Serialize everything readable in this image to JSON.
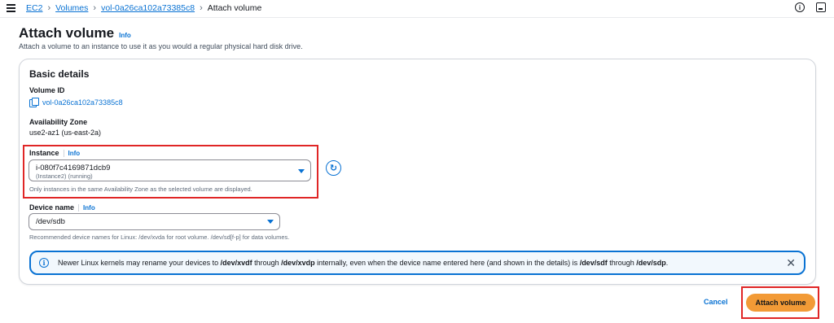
{
  "breadcrumb": {
    "items": [
      "EC2",
      "Volumes",
      "vol-0a26ca102a73385c8"
    ],
    "current": "Attach volume"
  },
  "header": {
    "title": "Attach volume",
    "info": "Info",
    "description": "Attach a volume to an instance to use it as you would a regular physical hard disk drive."
  },
  "basic_details": {
    "title": "Basic details",
    "volume_id_label": "Volume ID",
    "volume_id": "vol-0a26ca102a73385c8",
    "az_label": "Availability Zone",
    "az_value": "use2-az1 (us-east-2a)",
    "instance_label": "Instance",
    "instance_info": "Info",
    "instance_value": "i-080f7c4169871dcb9",
    "instance_sub": "(Instance2) (running)",
    "instance_hint": "Only instances in the same Availability Zone as the selected volume are displayed.",
    "device_label": "Device name",
    "device_info": "Info",
    "device_value": "/dev/sdb",
    "device_hint": "Recommended device names for Linux: /dev/xvda for root volume. /dev/sd[f-p] for data volumes."
  },
  "alert": {
    "part1": "Newer Linux kernels may rename your devices to ",
    "b1": "/dev/xvdf",
    "part2": " through ",
    "b2": "/dev/xvdp",
    "part3": " internally, even when the device name entered here (and shown in the details) is ",
    "b3": "/dev/sdf",
    "part4": " through ",
    "b4": "/dev/sdp",
    "part5": "."
  },
  "actions": {
    "cancel": "Cancel",
    "attach": "Attach volume"
  },
  "colors": {
    "link": "#0972d3",
    "primary_button": "#f29a36",
    "highlight": "#e02626",
    "alert_bg": "#f2f8fd"
  }
}
